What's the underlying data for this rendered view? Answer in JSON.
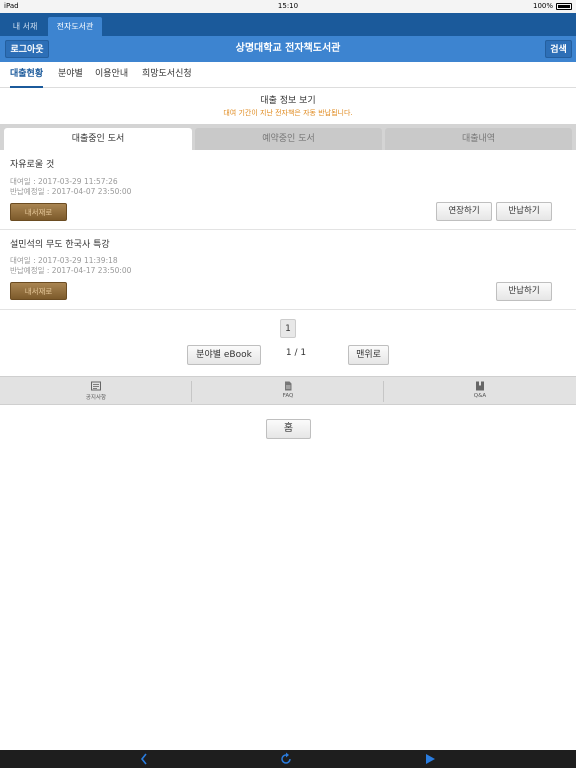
{
  "status_bar": {
    "device": "iPad",
    "time": "15:10",
    "battery": "100%"
  },
  "top_tabs": [
    {
      "label": "내 서재"
    },
    {
      "label": "전자도서관"
    }
  ],
  "header": {
    "logout_label": "로그아웃",
    "title": "상명대학교 전자책도서관",
    "search_label": "검색"
  },
  "sub_nav": [
    {
      "label": "대출현황"
    },
    {
      "label": "분야별"
    },
    {
      "label": "이용안내"
    },
    {
      "label": "희망도서신청"
    }
  ],
  "info": {
    "title": "대출 정보 보기",
    "notice": "대여 기간이 지난 전자책은 자동 반납됩니다."
  },
  "tabs": [
    {
      "label": "대출중인 도서"
    },
    {
      "label": "예약중인 도서"
    },
    {
      "label": "대출내역"
    }
  ],
  "books": [
    {
      "title": "자유로울 것",
      "borrow_date": "대여일 : 2017-03-29 11:57:26",
      "due_date": "반납예정일 : 2017-04-07 23:50:00",
      "shelf_label": "내서재로",
      "extend_label": "연장하기",
      "return_label": "반납하기"
    },
    {
      "title": "설민석의 무도 한국사 특강",
      "borrow_date": "대여일 : 2017-03-29 11:39:18",
      "due_date": "반납예정일 : 2017-04-17 23:50:00",
      "shelf_label": "내서재로",
      "return_label": "반납하기"
    }
  ],
  "pagination": {
    "current_page": "1",
    "page_count": "1 / 1",
    "category_button": "분야별 eBook",
    "top_button": "맨위로"
  },
  "footer_menu": [
    {
      "label": "공지사항",
      "icon": "notice-icon"
    },
    {
      "label": "FAQ",
      "icon": "document-icon"
    },
    {
      "label": "Q&A",
      "icon": "book-icon"
    }
  ],
  "home_button": "홈",
  "colors": {
    "header_blue": "#3d84d0",
    "tab_dark_blue": "#1b5a9b",
    "notice_orange": "#e08a1e",
    "brown_button": "#8a6a3c"
  },
  "toolbar": {
    "back_icon": "back-arrow-icon",
    "reload_icon": "reload-icon",
    "forward_icon": "forward-arrow-icon"
  }
}
